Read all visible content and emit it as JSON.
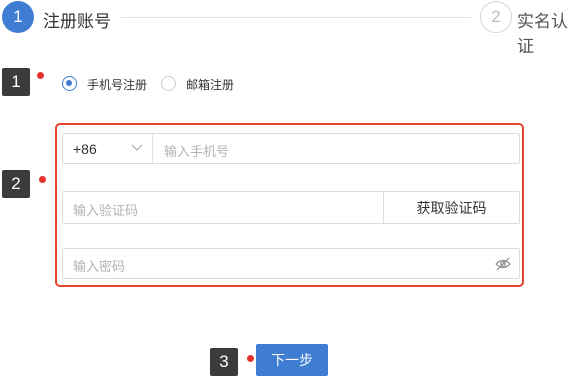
{
  "steps": [
    {
      "number": "1",
      "label": "注册账号"
    },
    {
      "number": "2",
      "label": "实名认证"
    }
  ],
  "annotations": [
    "1",
    "2",
    "3"
  ],
  "register_method": {
    "options": [
      {
        "label": "手机号注册",
        "checked": true
      },
      {
        "label": "邮箱注册",
        "checked": false
      }
    ]
  },
  "form": {
    "country_code": "+86",
    "phone_placeholder": "输入手机号",
    "code_placeholder": "输入验证码",
    "get_code_label": "获取验证码",
    "password_placeholder": "输入密码"
  },
  "next_label": "下一步",
  "colors": {
    "primary": "#3f7dd3",
    "highlight": "#e0452c",
    "marker": "#3b3b3b"
  }
}
